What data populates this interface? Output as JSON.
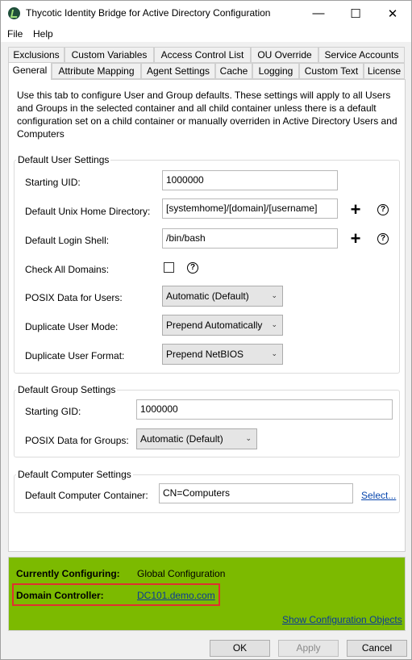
{
  "window": {
    "title": "Thycotic Identity Bridge for Active Directory Configuration",
    "minimize_glyph": "—",
    "maximize_glyph": "☐",
    "close_glyph": "✕"
  },
  "menu": {
    "file": "File",
    "help": "Help"
  },
  "tabs_row1": [
    "Exclusions",
    "Custom Variables",
    "Access Control List",
    "OU Override",
    "Service Accounts"
  ],
  "tabs_row2": [
    "General",
    "Attribute Mapping",
    "Agent Settings",
    "Cache",
    "Logging",
    "Custom Text",
    "License"
  ],
  "active_tab": "General",
  "description": "Use this tab to configure User and Group defaults. These settings will apply to all Users and Groups in the selected container and all child container unless there is a default configuration set on a child container or manually overriden in Active Directory Users and Computers",
  "user_settings": {
    "legend": "Default User Settings",
    "starting_uid_label": "Starting UID:",
    "starting_uid": "1000000",
    "home_dir_label": "Default Unix Home Directory:",
    "home_dir": "[systemhome]/[domain]/[username]",
    "login_shell_label": "Default Login Shell:",
    "login_shell": "/bin/bash",
    "check_all_domains_label": "Check All Domains:",
    "check_all_domains": false,
    "posix_users_label": "POSIX Data for Users:",
    "posix_users": "Automatic (Default)",
    "dup_mode_label": "Duplicate User Mode:",
    "dup_mode": "Prepend Automatically",
    "dup_format_label": "Duplicate User Format:",
    "dup_format": "Prepend NetBIOS"
  },
  "group_settings": {
    "legend": "Default Group Settings",
    "starting_gid_label": "Starting GID:",
    "starting_gid": "1000000",
    "posix_groups_label": "POSIX Data for Groups:",
    "posix_groups": "Automatic (Default)"
  },
  "computer_settings": {
    "legend": "Default Computer Settings",
    "container_label": "Default Computer Container:",
    "container": "CN=Computers",
    "select_link": "Select..."
  },
  "icons": {
    "plus": "+",
    "help": "?",
    "chevron": "⌄"
  },
  "status": {
    "configuring_label": "Currently Configuring:",
    "configuring_value": "Global Configuration",
    "dc_label": "Domain Controller:",
    "dc_value": "DC101.demo.com",
    "show_objects_link": "Show Configuration Objects",
    "background": "#7cba00",
    "highlight": "#e03030"
  },
  "buttons": {
    "ok": "OK",
    "apply": "Apply",
    "cancel": "Cancel"
  }
}
